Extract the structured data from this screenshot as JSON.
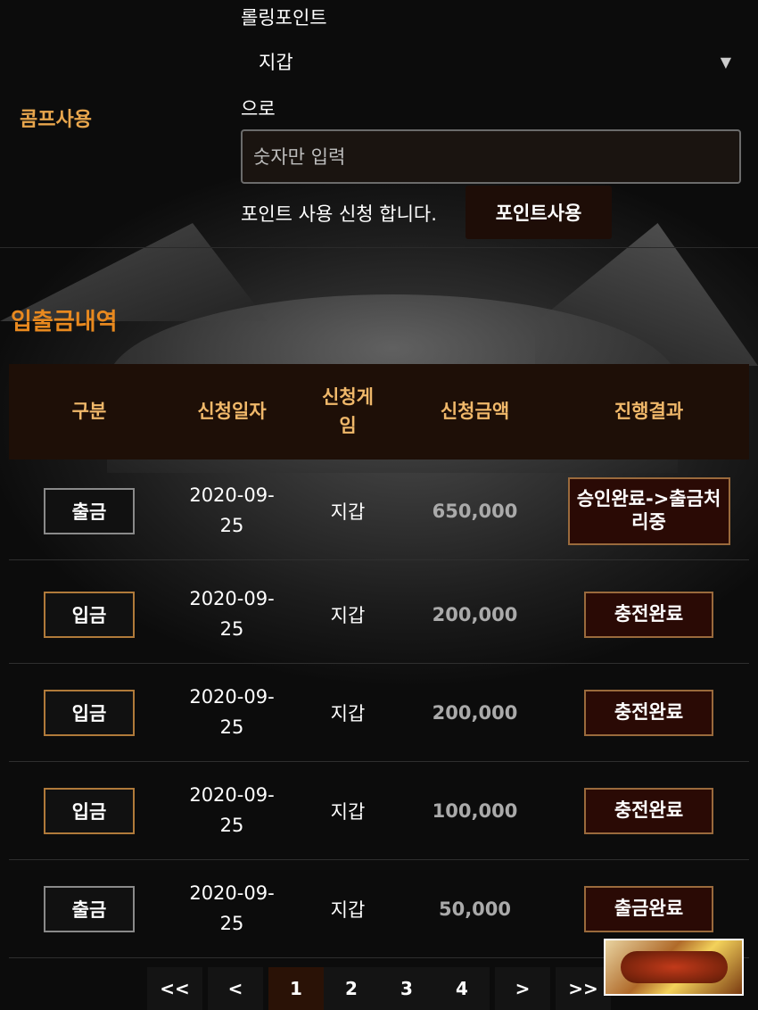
{
  "point_use": {
    "comp_label": "콤프사용",
    "rolling_label": "롤링포인트",
    "wallet_selected": "지갑",
    "euro_label": "으로",
    "amount_placeholder": "숫자만 입력",
    "apply_text": "포인트 사용 신청 합니다.",
    "use_button": "포인트사용"
  },
  "history": {
    "title": "입출금내역",
    "headers": [
      "구분",
      "신청일자",
      "신청게임",
      "신청금액",
      "진행결과"
    ],
    "rows": [
      {
        "type": "출금",
        "date_line1": "2020-09-",
        "date_line2": "25",
        "game": "지갑",
        "amount": "650,000",
        "status": "승인완료->출금처리중"
      },
      {
        "type": "입금",
        "date_line1": "2020-09-",
        "date_line2": "25",
        "game": "지갑",
        "amount": "200,000",
        "status": "충전완료"
      },
      {
        "type": "입금",
        "date_line1": "2020-09-",
        "date_line2": "25",
        "game": "지갑",
        "amount": "200,000",
        "status": "충전완료"
      },
      {
        "type": "입금",
        "date_line1": "2020-09-",
        "date_line2": "25",
        "game": "지갑",
        "amount": "100,000",
        "status": "충전완료"
      },
      {
        "type": "출금",
        "date_line1": "2020-09-",
        "date_line2": "25",
        "game": "지갑",
        "amount": "50,000",
        "status": "출금완료"
      }
    ]
  },
  "pagination": {
    "first": "<<",
    "prev": "<",
    "pages": [
      "1",
      "2",
      "3",
      "4"
    ],
    "current": "1",
    "next": ">",
    "last": ">>"
  }
}
